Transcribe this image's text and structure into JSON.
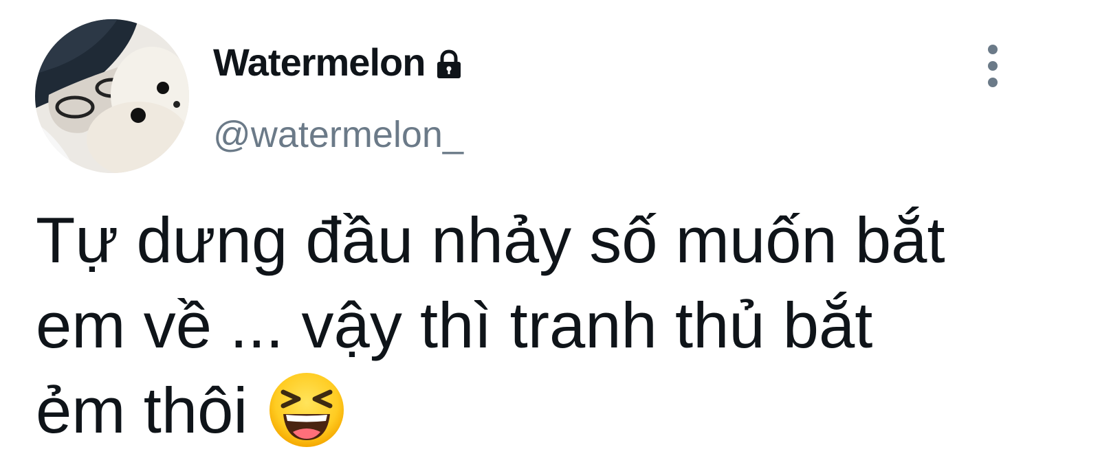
{
  "author": {
    "display_name": "Watermelon",
    "handle": "@watermelon_",
    "protected": true,
    "avatar": "avatar-image"
  },
  "icons": {
    "lock": "lock-icon",
    "more": "more-vertical-icon",
    "emoji": "laughing-squinting-face-emoji"
  },
  "tweet": {
    "lines": [
      "Tự dưng đầu nhảy số muốn bắt",
      "em về ... vậy thì tranh thủ bắt",
      "ẻm thôi"
    ]
  },
  "colors": {
    "text": "#0f1419",
    "secondary": "#6b7a88",
    "background": "#ffffff"
  }
}
